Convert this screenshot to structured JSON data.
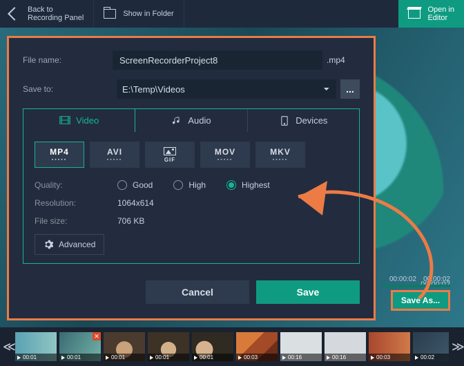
{
  "topbar": {
    "back": "Back to\nRecording Panel",
    "back_line1": "Back to",
    "back_line2": "Recording Panel",
    "show_folder": "Show in Folder",
    "open_editor_l1": "Open in",
    "open_editor_l2": "Editor"
  },
  "dialog": {
    "filename_label": "File name:",
    "filename_value": "ScreenRecorderProject8",
    "filename_ext": ".mp4",
    "saveto_label": "Save to:",
    "saveto_value": "E:\\Temp\\Videos",
    "browse": "...",
    "tabs": {
      "video": "Video",
      "audio": "Audio",
      "devices": "Devices"
    },
    "formats": [
      "MP4",
      "AVI",
      "GIF",
      "MOV",
      "MKV"
    ],
    "format_sub": "▸▸▸▸▸",
    "selected_format": "MP4",
    "quality_label": "Quality:",
    "quality_options": [
      "Good",
      "High",
      "Highest"
    ],
    "quality_selected": "Highest",
    "resolution_label": "Resolution:",
    "resolution_value": "1064x614",
    "filesize_label": "File size:",
    "filesize_value": "706 KB",
    "advanced": "Advanced",
    "cancel": "Cancel",
    "save": "Save"
  },
  "saveas": "Save As...",
  "ticks": {
    "t1": "00:00:02",
    "t2": "00:00:02",
    "display": "00:00:02"
  },
  "thumbs": [
    {
      "t": "00:01",
      "c": "t1"
    },
    {
      "t": "00:01",
      "c": "t2",
      "sel": true,
      "x": true
    },
    {
      "t": "00:01",
      "c": "t3"
    },
    {
      "t": "00:01",
      "c": "t4"
    },
    {
      "t": "00:01",
      "c": "t5"
    },
    {
      "t": "00:03",
      "c": "t6"
    },
    {
      "t": "00:16",
      "c": "t7"
    },
    {
      "t": "00:16",
      "c": "t8"
    },
    {
      "t": "00:03",
      "c": "t9"
    },
    {
      "t": "00:02",
      "c": "t10"
    }
  ]
}
